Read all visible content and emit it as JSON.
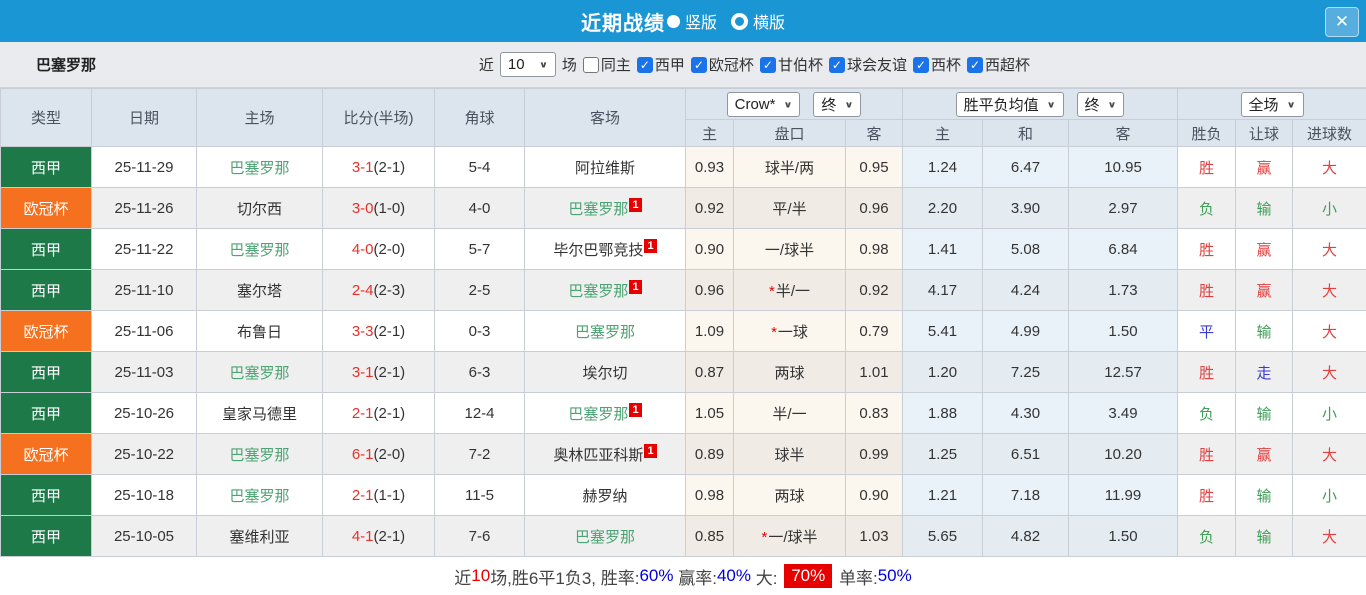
{
  "colors": {
    "accent_blue": "#1b96d5",
    "close_btn_blue": "#55aede",
    "red": "#e24040",
    "green": "#3f9e57",
    "blue": "#3a3ad6",
    "barca_green": "#4ca373",
    "league_green": "#1d7a48",
    "cup_orange": "#f6711f",
    "checkbox_blue": "#1a73e8",
    "value_blue": "#0000dd",
    "badge_red": "#e60000",
    "score_red": "#e8302a",
    "header_bg": "#dce5ee",
    "filter_bg": "#e9ebee",
    "row_alt": "#efefef",
    "hcp_tint": "#fbf7ee",
    "hcp_tint_alt": "#f0ece5",
    "eu_tint": "#e9f2f8",
    "eu_tint_alt": "#e4ebf1"
  },
  "icons": {
    "close": "✕",
    "check": "✓",
    "chevron_down": "∨",
    "star": "*"
  },
  "title_bar": {
    "title": "近期战绩",
    "radio_selected_label": "竖版",
    "radio_unselected_label": "横版"
  },
  "filter_bar": {
    "team_name": "巴塞罗那",
    "near_label": "近",
    "near_value": "10",
    "unit_label": "场",
    "same_home_label": "同主",
    "league_checkboxes": [
      "西甲",
      "欧冠杯",
      "甘伯杯",
      "球会友谊",
      "西杯",
      "西超杯"
    ]
  },
  "table": {
    "headers": {
      "type": "类型",
      "date": "日期",
      "home": "主场",
      "score": "比分(半场)",
      "corner": "角球",
      "away": "客场"
    },
    "sub_headers": [
      "主",
      "盘口",
      "客",
      "主",
      "和",
      "客",
      "胜负",
      "让球",
      "进球数"
    ],
    "dropdowns": {
      "bookmaker": "Crow*",
      "bookmaker_period": "终",
      "avg": "胜平负均值",
      "avg_period": "终",
      "scope": "全场"
    },
    "rows": [
      {
        "type": "西甲",
        "type_color": "league_green",
        "date": "25-11-29",
        "home": "巴塞罗那",
        "home_is_focus": true,
        "home_badge": "",
        "score": "3-1",
        "score_half": "(2-1)",
        "corner": "5-4",
        "away": "阿拉维斯",
        "away_is_focus": false,
        "away_badge": "",
        "hcp_home": "0.93",
        "hcp_star": false,
        "hcp_line": "球半/两",
        "hcp_away": "0.95",
        "eu_home": "1.24",
        "eu_draw": "6.47",
        "eu_away": "10.95",
        "result": "胜",
        "result_color": "red",
        "handicap_result": "赢",
        "handicap_color": "red",
        "goals_result": "大",
        "goals_color": "red"
      },
      {
        "type": "欧冠杯",
        "type_color": "cup_orange",
        "date": "25-11-26",
        "home": "切尔西",
        "home_is_focus": false,
        "home_badge": "",
        "score": "3-0",
        "score_half": "(1-0)",
        "corner": "4-0",
        "away": "巴塞罗那",
        "away_is_focus": true,
        "away_badge": "1",
        "hcp_home": "0.92",
        "hcp_star": false,
        "hcp_line": "平/半",
        "hcp_away": "0.96",
        "eu_home": "2.20",
        "eu_draw": "3.90",
        "eu_away": "2.97",
        "result": "负",
        "result_color": "green",
        "handicap_result": "输",
        "handicap_color": "green",
        "goals_result": "小",
        "goals_color": "green"
      },
      {
        "type": "西甲",
        "type_color": "league_green",
        "date": "25-11-22",
        "home": "巴塞罗那",
        "home_is_focus": true,
        "home_badge": "",
        "score": "4-0",
        "score_half": "(2-0)",
        "corner": "5-7",
        "away": "毕尔巴鄂竞技",
        "away_is_focus": false,
        "away_badge": "1",
        "hcp_home": "0.90",
        "hcp_star": false,
        "hcp_line": "一/球半",
        "hcp_away": "0.98",
        "eu_home": "1.41",
        "eu_draw": "5.08",
        "eu_away": "6.84",
        "result": "胜",
        "result_color": "red",
        "handicap_result": "赢",
        "handicap_color": "red",
        "goals_result": "大",
        "goals_color": "red"
      },
      {
        "type": "西甲",
        "type_color": "league_green",
        "date": "25-11-10",
        "home": "塞尔塔",
        "home_is_focus": false,
        "home_badge": "",
        "score": "2-4",
        "score_half": "(2-3)",
        "corner": "2-5",
        "away": "巴塞罗那",
        "away_is_focus": true,
        "away_badge": "1",
        "hcp_home": "0.96",
        "hcp_star": true,
        "hcp_line": "半/一",
        "hcp_away": "0.92",
        "eu_home": "4.17",
        "eu_draw": "4.24",
        "eu_away": "1.73",
        "result": "胜",
        "result_color": "red",
        "handicap_result": "赢",
        "handicap_color": "red",
        "goals_result": "大",
        "goals_color": "red"
      },
      {
        "type": "欧冠杯",
        "type_color": "cup_orange",
        "date": "25-11-06",
        "home": "布鲁日",
        "home_is_focus": false,
        "home_badge": "",
        "score": "3-3",
        "score_half": "(2-1)",
        "corner": "0-3",
        "away": "巴塞罗那",
        "away_is_focus": true,
        "away_badge": "",
        "hcp_home": "1.09",
        "hcp_star": true,
        "hcp_line": "一球",
        "hcp_away": "0.79",
        "eu_home": "5.41",
        "eu_draw": "4.99",
        "eu_away": "1.50",
        "result": "平",
        "result_color": "blue",
        "handicap_result": "输",
        "handicap_color": "green",
        "goals_result": "大",
        "goals_color": "red"
      },
      {
        "type": "西甲",
        "type_color": "league_green",
        "date": "25-11-03",
        "home": "巴塞罗那",
        "home_is_focus": true,
        "home_badge": "",
        "score": "3-1",
        "score_half": "(2-1)",
        "corner": "6-3",
        "away": "埃尔切",
        "away_is_focus": false,
        "away_badge": "",
        "hcp_home": "0.87",
        "hcp_star": false,
        "hcp_line": "两球",
        "hcp_away": "1.01",
        "eu_home": "1.20",
        "eu_draw": "7.25",
        "eu_away": "12.57",
        "result": "胜",
        "result_color": "red",
        "handicap_result": "走",
        "handicap_color": "blue",
        "goals_result": "大",
        "goals_color": "red"
      },
      {
        "type": "西甲",
        "type_color": "league_green",
        "date": "25-10-26",
        "home": "皇家马德里",
        "home_is_focus": false,
        "home_badge": "",
        "score": "2-1",
        "score_half": "(2-1)",
        "corner": "12-4",
        "away": "巴塞罗那",
        "away_is_focus": true,
        "away_badge": "1",
        "hcp_home": "1.05",
        "hcp_star": false,
        "hcp_line": "半/一",
        "hcp_away": "0.83",
        "eu_home": "1.88",
        "eu_draw": "4.30",
        "eu_away": "3.49",
        "result": "负",
        "result_color": "green",
        "handicap_result": "输",
        "handicap_color": "green",
        "goals_result": "小",
        "goals_color": "green"
      },
      {
        "type": "欧冠杯",
        "type_color": "cup_orange",
        "date": "25-10-22",
        "home": "巴塞罗那",
        "home_is_focus": true,
        "home_badge": "",
        "score": "6-1",
        "score_half": "(2-0)",
        "corner": "7-2",
        "away": "奥林匹亚科斯",
        "away_is_focus": false,
        "away_badge": "1",
        "hcp_home": "0.89",
        "hcp_star": false,
        "hcp_line": "球半",
        "hcp_away": "0.99",
        "eu_home": "1.25",
        "eu_draw": "6.51",
        "eu_away": "10.20",
        "result": "胜",
        "result_color": "red",
        "handicap_result": "赢",
        "handicap_color": "red",
        "goals_result": "大",
        "goals_color": "red"
      },
      {
        "type": "西甲",
        "type_color": "league_green",
        "date": "25-10-18",
        "home": "巴塞罗那",
        "home_is_focus": true,
        "home_badge": "",
        "score": "2-1",
        "score_half": "(1-1)",
        "corner": "11-5",
        "away": "赫罗纳",
        "away_is_focus": false,
        "away_badge": "",
        "hcp_home": "0.98",
        "hcp_star": false,
        "hcp_line": "两球",
        "hcp_away": "0.90",
        "eu_home": "1.21",
        "eu_draw": "7.18",
        "eu_away": "11.99",
        "result": "胜",
        "result_color": "red",
        "handicap_result": "输",
        "handicap_color": "green",
        "goals_result": "小",
        "goals_color": "green"
      },
      {
        "type": "西甲",
        "type_color": "league_green",
        "date": "25-10-05",
        "home": "塞维利亚",
        "home_is_focus": false,
        "home_badge": "",
        "score": "4-1",
        "score_half": "(2-1)",
        "corner": "7-6",
        "away": "巴塞罗那",
        "away_is_focus": true,
        "away_badge": "",
        "hcp_home": "0.85",
        "hcp_star": true,
        "hcp_line": "一/球半",
        "hcp_away": "1.03",
        "eu_home": "5.65",
        "eu_draw": "4.82",
        "eu_away": "1.50",
        "result": "负",
        "result_color": "green",
        "handicap_result": "输",
        "handicap_color": "green",
        "goals_result": "大",
        "goals_color": "red"
      }
    ]
  },
  "footer": {
    "segments": [
      {
        "text": "近",
        "style": "dark"
      },
      {
        "text": "10",
        "style": "red"
      },
      {
        "text": "场,胜6平1负3, ",
        "style": "dark"
      },
      {
        "text": "胜率:",
        "style": "dark"
      },
      {
        "text": "60%",
        "style": "blue"
      },
      {
        "text": " 赢率:",
        "style": "dark"
      },
      {
        "text": "40%",
        "style": "blue"
      },
      {
        "text": " 大: ",
        "style": "dark"
      },
      {
        "text": "70%",
        "style": "red_badge"
      },
      {
        "text": " 单率:",
        "style": "dark"
      },
      {
        "text": "50%",
        "style": "blue"
      }
    ]
  }
}
